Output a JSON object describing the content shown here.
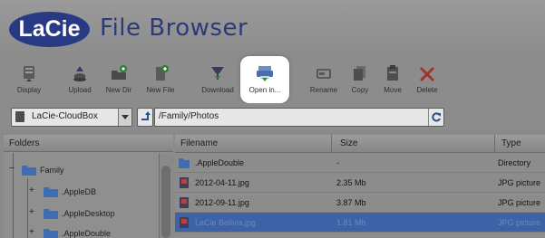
{
  "header": {
    "logo_text": "LaCie",
    "title": "File Browser"
  },
  "toolbar": {
    "buttons": [
      {
        "label": "Display",
        "icon": "display-icon"
      },
      {
        "label": "Upload",
        "icon": "upload-icon"
      },
      {
        "label": "New Dir",
        "icon": "new-folder-icon"
      },
      {
        "label": "New File",
        "icon": "new-file-icon"
      },
      {
        "label": "Download",
        "icon": "download-icon"
      },
      {
        "label": "Open in...",
        "icon": "open-in-icon",
        "highlighted": true
      },
      {
        "label": "Rename",
        "icon": "rename-icon"
      },
      {
        "label": "Copy",
        "icon": "copy-icon"
      },
      {
        "label": "Move",
        "icon": "move-icon"
      },
      {
        "label": "Delete",
        "icon": "delete-icon"
      }
    ]
  },
  "location": {
    "device": "LaCie-CloudBox",
    "path": "/Family/Photos"
  },
  "folders": {
    "header": "Folders",
    "items": [
      {
        "label": "Family"
      },
      {
        "label": ".AppleDB"
      },
      {
        "label": ".AppleDesktop"
      },
      {
        "label": ".AppleDouble"
      }
    ]
  },
  "files": {
    "columns": [
      "Filename",
      "Size",
      "Type"
    ],
    "rows": [
      {
        "name": ".AppleDouble",
        "size": "-",
        "type": "Directory",
        "kind": "folder"
      },
      {
        "name": "2012-04-11.jpg",
        "size": "2.35 Mb",
        "type": "JPG picture",
        "kind": "image"
      },
      {
        "name": "2012-09-11.jpg",
        "size": "3.87 Mb",
        "type": "JPG picture",
        "kind": "image"
      },
      {
        "name": "LaCie Bolivia.jpg",
        "size": "1.81 Mb",
        "type": "JPG picture",
        "kind": "image",
        "selected": true
      }
    ]
  },
  "colors": {
    "brand_blue": "#283a84",
    "selection_blue": "#3c63a8",
    "chrome_gray": "#8c8c8c"
  }
}
